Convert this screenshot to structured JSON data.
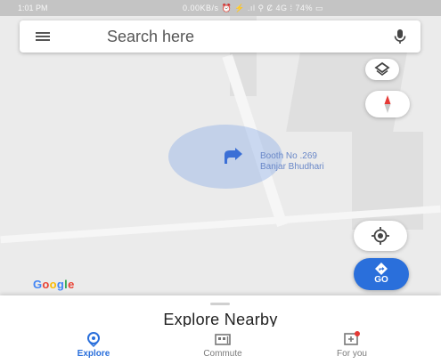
{
  "status_bar": {
    "time": "1:01 PM",
    "icons_text": "0.00KB/s ⏰ ⚡ .ıl ⚲ Ȼ 4G ⁞ 74% ▭"
  },
  "search": {
    "placeholder": "Search here",
    "menu_icon": "hamburger-menu-icon",
    "mic_icon": "microphone-icon"
  },
  "map": {
    "place_label_line1": "Booth No .269",
    "place_label_line2": "Banjar Bhudhari",
    "attribution": "Google",
    "accent_color": "#2a6fdb",
    "controls": {
      "layers_icon": "layers-icon",
      "compass_icon": "compass-icon",
      "location_icon": "my-location-icon",
      "go_icon": "directions-icon",
      "go_label": "GO"
    }
  },
  "bottom_sheet": {
    "title": "Explore Nearby"
  },
  "bottom_nav": {
    "items": [
      {
        "label": "Explore",
        "icon": "explore-pin-icon",
        "active": true
      },
      {
        "label": "Commute",
        "icon": "commute-icon",
        "active": false
      },
      {
        "label": "For you",
        "icon": "for-you-icon",
        "active": false
      }
    ]
  }
}
